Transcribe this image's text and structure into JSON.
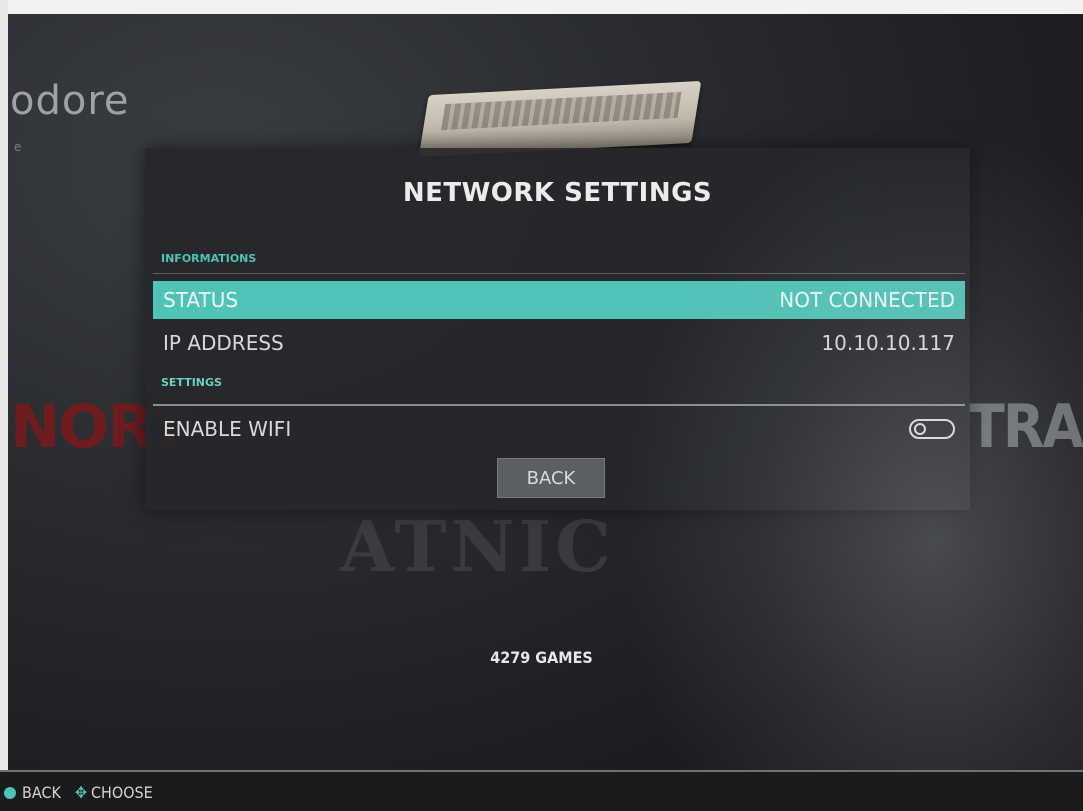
{
  "background": {
    "system_title": "odore",
    "system_subtitle": "e",
    "logo_left": "NORT",
    "logo_right": "TRAD",
    "logo_bottom": "ATNIC"
  },
  "dialog": {
    "title": "NETWORK SETTINGS",
    "sections": {
      "informations": "INFORMATIONS",
      "settings": "SETTINGS"
    },
    "rows": {
      "status": {
        "label": "STATUS",
        "value": "NOT CONNECTED"
      },
      "ip": {
        "label": "IP ADDRESS",
        "value": "10.10.10.117"
      },
      "wifi": {
        "label": "ENABLE WIFI",
        "enabled": false
      }
    },
    "back_label": "BACK"
  },
  "footer": {
    "games_count": "4279 GAMES"
  },
  "help_bar": {
    "back_label": "BACK",
    "choose_label": "CHOOSE"
  },
  "colors": {
    "accent": "#4fc3b5",
    "dialog_bg": "#26272a",
    "text": "#d8d9da"
  },
  "icons": {
    "help_back": "circle-button-icon",
    "help_choose": "dpad-icon"
  }
}
